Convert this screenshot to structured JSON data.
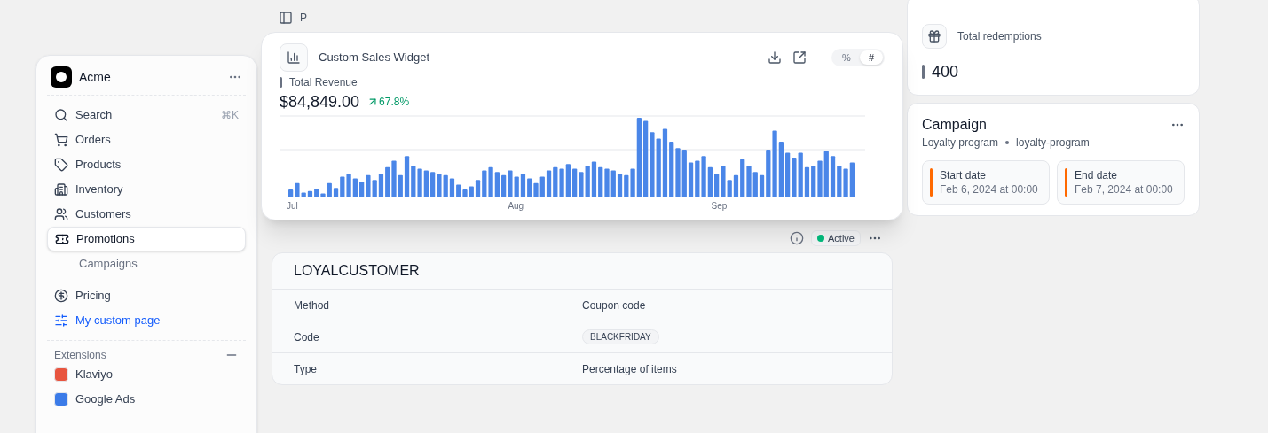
{
  "sidebar": {
    "store_name": "Acme",
    "search": {
      "label": "Search",
      "shortcut": "⌘K"
    },
    "nav_items": [
      {
        "label": "Orders",
        "selected": false
      },
      {
        "label": "Products",
        "selected": false
      },
      {
        "label": "Inventory",
        "selected": false
      },
      {
        "label": "Customers",
        "selected": false
      },
      {
        "label": "Promotions",
        "selected": true,
        "children": [
          {
            "label": "Campaigns"
          }
        ]
      }
    ],
    "extra_items": [
      {
        "label": "Pricing",
        "kind": "plain"
      },
      {
        "label": "My custom page",
        "kind": "link"
      }
    ],
    "extensions": {
      "title": "Extensions",
      "items": [
        {
          "label": "Klaviyo",
          "color": "#e8553f"
        },
        {
          "label": "Google Ads",
          "color": "#3b7be8"
        }
      ]
    }
  },
  "header": {
    "breadcrumb": "P"
  },
  "widget": {
    "title": "Custom Sales Widget",
    "metric_label": "Total Revenue",
    "value": "$84,849.00",
    "change": "67.8%",
    "toggle": [
      {
        "label": "%",
        "selected": false
      },
      {
        "label": "#",
        "selected": true
      }
    ],
    "x_labels": [
      "Jul",
      "Aug",
      "Sep"
    ]
  },
  "coupon": {
    "status": "Active",
    "code": "LOYALCUSTOMER",
    "rows": [
      {
        "label": "Method",
        "value": "Coupon code",
        "kind": "text"
      },
      {
        "label": "Code",
        "value": "BLACKFRIDAY",
        "kind": "badge"
      },
      {
        "label": "Type",
        "value": "Percentage of items",
        "kind": "text"
      }
    ]
  },
  "redemptions": {
    "label": "Total redemptions",
    "value": "400"
  },
  "campaign": {
    "title": "Campaign",
    "name": "Loyalty program",
    "handle": "loyalty-program",
    "dates": [
      {
        "label": "Start date",
        "value": "Feb 6, 2024 at 00:00"
      },
      {
        "label": "End date",
        "value": "Feb 7, 2024 at 00:00"
      }
    ]
  }
}
